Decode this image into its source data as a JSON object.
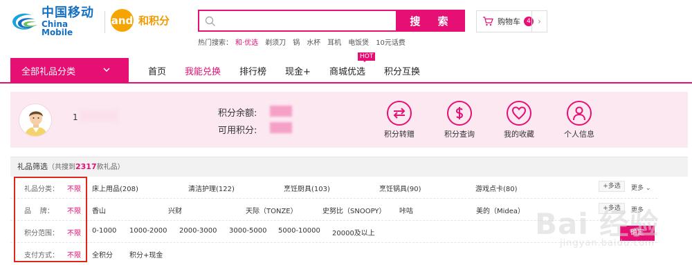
{
  "header": {
    "brand_cn": "中国移动",
    "brand_en": "China Mobile",
    "brand2_icon": "and",
    "brand2_name": "和积分",
    "search_button": "搜 索",
    "search_placeholder": "",
    "hot_label": "热门搜索：",
    "hot_items": [
      "和·优选",
      "剃须刀",
      "锅",
      "水杯",
      "耳机",
      "电饭煲",
      "10元话费"
    ],
    "cart_label": "购物车",
    "cart_count": "4",
    "cart_arrow": "›"
  },
  "nav": {
    "all_categories": "全部礼品分类",
    "items": [
      "首页",
      "我能兑换",
      "排行榜",
      "现金+",
      "商城优选",
      "积分互换"
    ],
    "hot_badge": "HOT"
  },
  "user": {
    "phone_prefix": "1",
    "points_balance_label": "积分余额:",
    "points_available_label": "可用积分:",
    "actions": [
      "积分转赠",
      "积分查询",
      "我的收藏",
      "个人信息"
    ]
  },
  "filter": {
    "title": "礼品筛选",
    "count_prefix": "（共搜到",
    "count": "2317",
    "count_suffix": "款礼品）",
    "unlimited": "不限",
    "multi_select": "+多选",
    "more": "更多",
    "confirm": "确定",
    "rows": [
      {
        "label": "礼品分类：",
        "options": [
          "床上用品(208)",
          "清洁护理(122)",
          "烹饪厨具(103)",
          "烹饪锅具(90)",
          "游戏点卡(80)"
        ]
      },
      {
        "label": "品    牌：",
        "options": [
          "香山",
          "兴财",
          "天际（TONZE）",
          "史努比（SNOOPY）",
          "咔咕",
          "美的（Midea）"
        ]
      },
      {
        "label": "积分范围：",
        "options": [
          "0-1000",
          "1000-2000",
          "2000-3000",
          "3000-5000",
          "5000-10000",
          "20000及以上"
        ]
      },
      {
        "label": "支付方式：",
        "options": [
          "全积分",
          "积分+现金"
        ]
      }
    ]
  },
  "watermark": {
    "big": "Bai 经验",
    "small": "jingyan.baidu.com"
  },
  "colors": {
    "accent": "#e60f73",
    "brand_blue": "#1670c2",
    "brand_orange": "#f39a00",
    "highlight_box": "#e0251d"
  }
}
